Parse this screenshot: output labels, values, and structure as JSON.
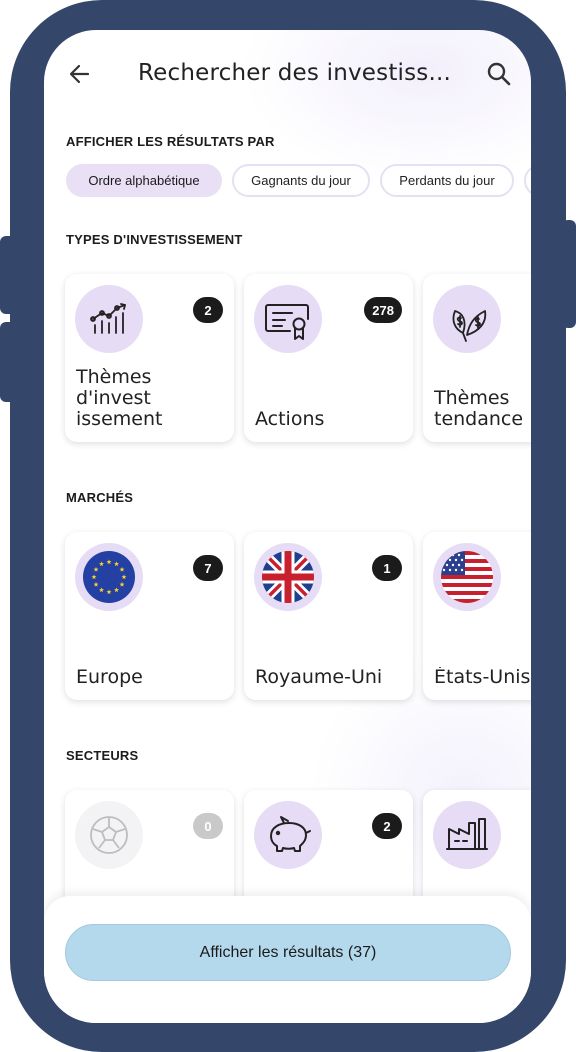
{
  "header": {
    "title": "Rechercher des investiss...",
    "back_icon": "arrow-left-icon",
    "search_icon": "search-icon"
  },
  "sort": {
    "label": "AFFICHER LES RÉSULTATS PAR",
    "chips": [
      {
        "label": "Ordre alphabétique",
        "selected": true
      },
      {
        "label": "Gagnants du jour",
        "selected": false
      },
      {
        "label": "Perdants du jour",
        "selected": false
      },
      {
        "label": "",
        "selected": false
      }
    ]
  },
  "types": {
    "label": "TYPES D'INVESTISSEMENT",
    "cards": [
      {
        "label": "Thèmes d'invest\nissement",
        "count": "2",
        "icon": "chart-bars-icon"
      },
      {
        "label": "Actions",
        "count": "278",
        "icon": "certificate-icon"
      },
      {
        "label": "Thèmes\ntendance",
        "count": "",
        "icon": "dollar-leaves-icon"
      }
    ]
  },
  "markets": {
    "label": "MARCHÉS",
    "cards": [
      {
        "label": "Europe",
        "count": "7",
        "icon": "eu-flag-icon"
      },
      {
        "label": "Royaume-Uni",
        "count": "1",
        "icon": "uk-flag-icon"
      },
      {
        "label": "États-Unis",
        "count": "",
        "icon": "us-flag-icon"
      }
    ]
  },
  "sectors": {
    "label": "SECTEURS",
    "cards": [
      {
        "label": "",
        "count": "0",
        "icon": "soccer-ball-icon"
      },
      {
        "label": "",
        "count": "2",
        "icon": "piggy-bank-icon"
      },
      {
        "label": "",
        "count": "",
        "icon": "factory-icon"
      }
    ]
  },
  "footer": {
    "button_label": "Afficher les résultats (37)"
  },
  "colors": {
    "frame": "#34466a",
    "chip_active": "#e9e0f6",
    "icon_circle": "#e6dcf5",
    "badge": "#1b1b1b",
    "button": "#b4d9ec"
  }
}
